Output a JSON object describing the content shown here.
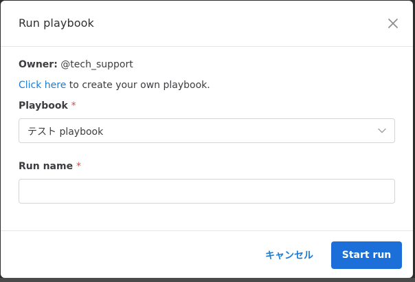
{
  "modal": {
    "title": "Run playbook",
    "close_icon": "close-icon"
  },
  "owner": {
    "label": "Owner:",
    "value": "@tech_support"
  },
  "create_hint": {
    "link_text": "Click here",
    "rest_text": " to create your own playbook."
  },
  "playbook_field": {
    "label": "Playbook",
    "required_mark": "*",
    "selected": "テスト playbook",
    "chevron_icon": "chevron-down-icon"
  },
  "run_name_field": {
    "label": "Run name",
    "required_mark": "*",
    "value": "",
    "placeholder": ""
  },
  "footer": {
    "cancel_label": "キャンセル",
    "start_label": "Start run"
  },
  "colors": {
    "accent": "#1c7bd4",
    "primary_button": "#1c6fd8",
    "required": "#d24b4e"
  }
}
